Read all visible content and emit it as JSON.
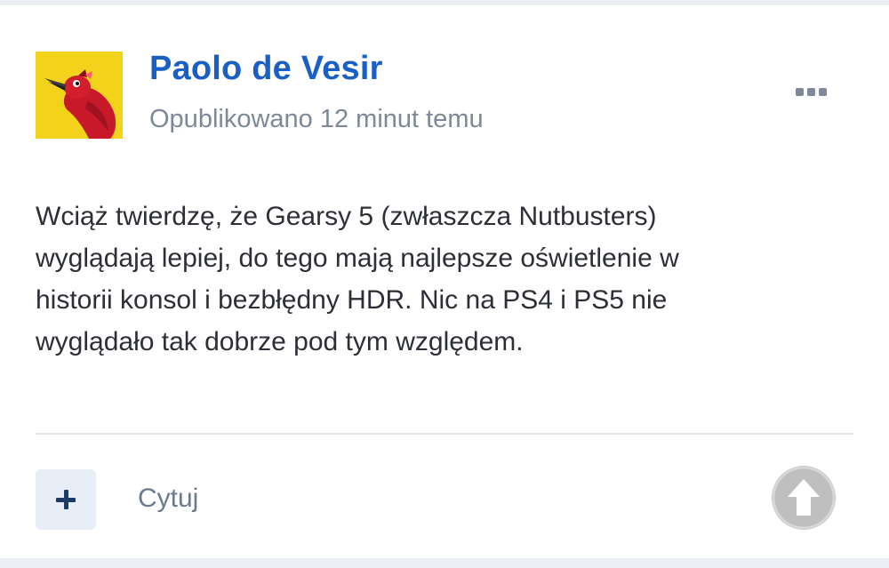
{
  "post": {
    "author": "Paolo de Vesir",
    "published": "Opublikowano 12 minut temu",
    "body": "Wciąż twierdzę, że Gearsy 5 (zwłaszcza Nutbusters)\nwyglądają lepiej, do tego mają najlepsze oświetlenie w\nhistorii konsol i bezbłędny HDR. Nic na PS4 i PS5 nie\nwyglądało tak dobrze pod tym względem."
  },
  "actions": {
    "quote_label": "Cytuj",
    "plus_icon": "plus-icon",
    "more_icon": "ellipsis-icon",
    "scroll_icon": "arrow-up-icon"
  },
  "colors": {
    "author": "#1a5fc4",
    "avatar_background": "#f2d21b",
    "bird": "#c8192a"
  }
}
